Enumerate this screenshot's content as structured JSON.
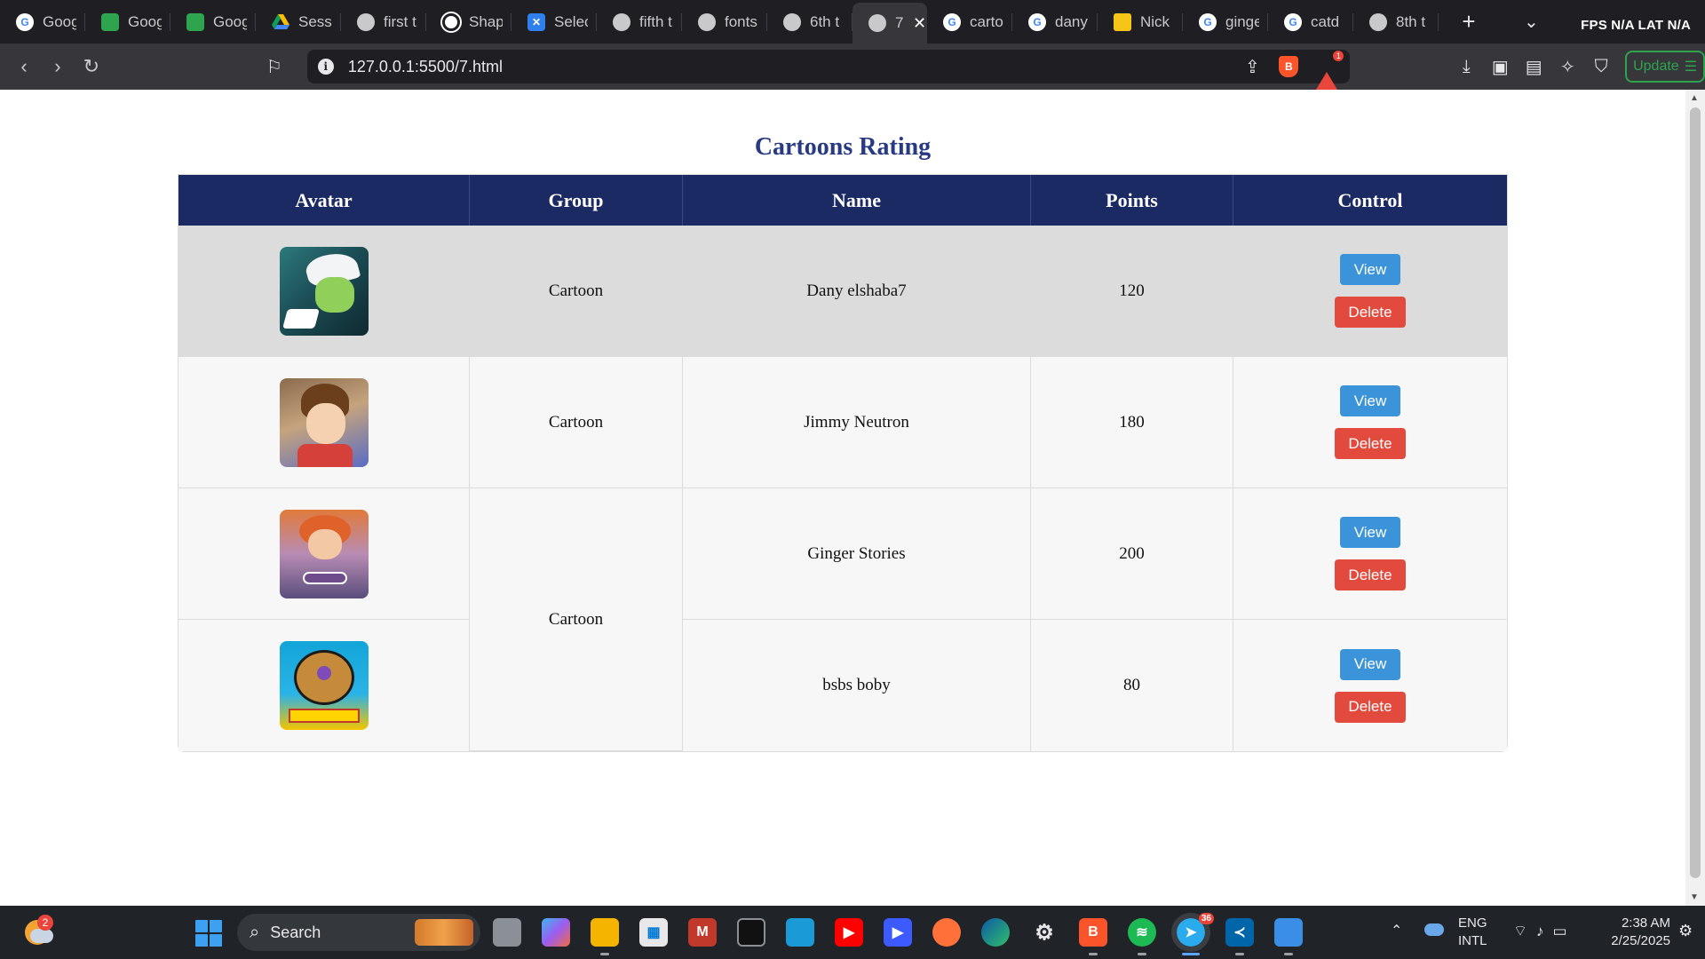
{
  "browser": {
    "tabs": [
      {
        "label": "Goog",
        "favicon": "google-icon"
      },
      {
        "label": "Goog",
        "favicon": "google-meet-icon"
      },
      {
        "label": "Goog",
        "favicon": "google-meet-icon"
      },
      {
        "label": "Sessi",
        "favicon": "google-drive-icon"
      },
      {
        "label": "first t",
        "favicon": "globe-icon"
      },
      {
        "label": "Shap",
        "favicon": "shape-icon"
      },
      {
        "label": "Selec",
        "favicon": "select-icon"
      },
      {
        "label": "fifth t",
        "favicon": "globe-icon"
      },
      {
        "label": "fonts",
        "favicon": "globe-icon"
      },
      {
        "label": "6th t",
        "favicon": "globe-icon"
      },
      {
        "label": "7",
        "favicon": "globe-icon",
        "active": true
      },
      {
        "label": "carto",
        "favicon": "google-icon"
      },
      {
        "label": "dany",
        "favicon": "google-icon"
      },
      {
        "label": "Nick",
        "favicon": "imdb-icon"
      },
      {
        "label": "ginge",
        "favicon": "google-icon"
      },
      {
        "label": "catd",
        "favicon": "google-icon"
      },
      {
        "label": "8th t",
        "favicon": "globe-icon"
      }
    ],
    "overlay_stats": "FPS N/A LAT N/A",
    "url": "127.0.0.1:5500/7.html",
    "rewards_badge": "1",
    "update_label": "Update"
  },
  "page": {
    "title": "Cartoons Rating",
    "columns": [
      "Avatar",
      "Group",
      "Name",
      "Points",
      "Control"
    ],
    "rows": [
      {
        "group": "Cartoon",
        "name": "Dany elshaba7",
        "points": "120"
      },
      {
        "group": "Cartoon",
        "name": "Jimmy Neutron",
        "points": "180"
      },
      {
        "group": "Cartoon",
        "name": "Ginger Stories",
        "points": "200"
      },
      {
        "group": "Cartoon",
        "name": "bsbs boby",
        "points": "80"
      }
    ],
    "view_label": "View",
    "delete_label": "Delete"
  },
  "taskbar": {
    "weather_badge": "2",
    "search_label": "Search",
    "telegram_badge": "36",
    "lang_line1": "ENG",
    "lang_line2": "INTL",
    "time": "2:38 AM",
    "date": "2/25/2025"
  }
}
